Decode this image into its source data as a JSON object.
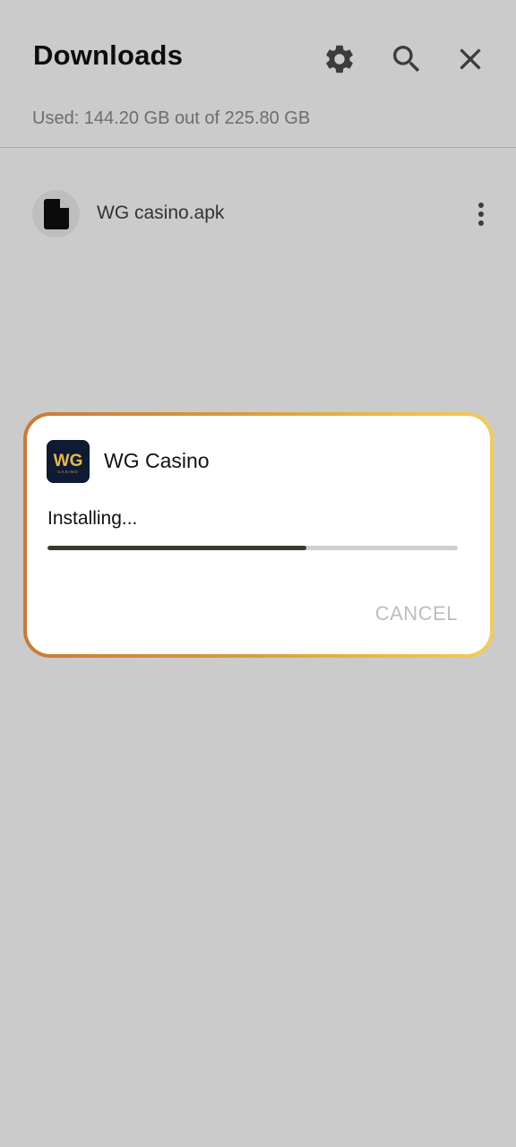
{
  "header": {
    "title": "Downloads",
    "storage_text": "Used: 144.20 GB out of 225.80 GB",
    "icons": [
      "gear-icon",
      "search-icon",
      "close-icon"
    ]
  },
  "files": [
    {
      "name": "WG casino.apk",
      "icon": "file-icon"
    }
  ],
  "install_dialog": {
    "app_name": "WG Casino",
    "app_icon_text": "WG",
    "app_icon_subtext": "CASINO",
    "status": "Installing...",
    "progress": 0.63,
    "cancel_label": "CANCEL"
  },
  "colors": {
    "background": "#cbcbcb",
    "dialog_border_start": "#c97a37",
    "dialog_border_end": "#f1cc5a",
    "progress_fill": "#3b3a28",
    "app_icon_bg": "#0e1b33",
    "app_icon_gold": "#e8b84a"
  }
}
